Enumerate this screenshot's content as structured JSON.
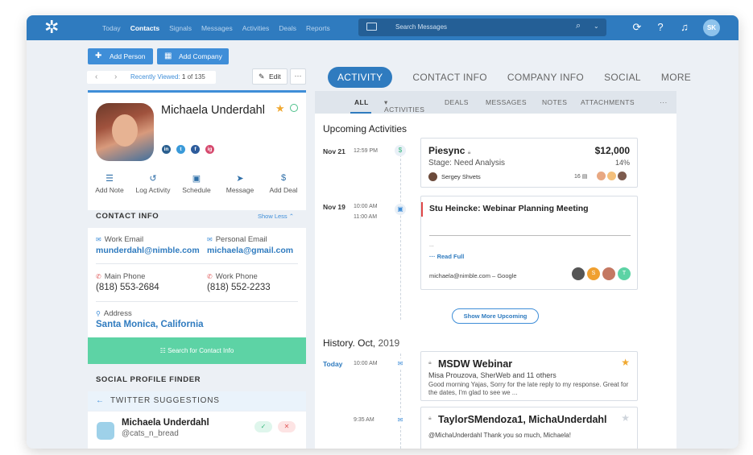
{
  "nav": {
    "items": [
      "Today",
      "Contacts",
      "Signals",
      "Messages",
      "Activities",
      "Deals",
      "Reports"
    ],
    "search_placeholder": "Search Messages",
    "avatar_initials": "SK"
  },
  "toolbar": {
    "add_person": "Add Person",
    "add_company": "Add Company",
    "recently_viewed_label": "Recently Viewed:",
    "recently_viewed_pos": "1",
    "recently_viewed_of": "of",
    "recently_viewed_total": "135",
    "edit": "Edit"
  },
  "profile": {
    "name": "Michaela Underdahl",
    "socials": [
      "in",
      "t",
      "f",
      "ig"
    ],
    "actions": [
      "Add Note",
      "Log Activity",
      "Schedule",
      "Message",
      "Add Deal"
    ]
  },
  "contact_info": {
    "title": "CONTACT INFO",
    "toggle": "Show Less",
    "work_email_label": "Work Email",
    "work_email": "munderdahl@nimble.com",
    "personal_email_label": "Personal Email",
    "personal_email": "michaela@gmail.com",
    "main_phone_label": "Main Phone",
    "main_phone": "(818) 553-2684",
    "work_phone_label": "Work Phone",
    "work_phone": "(818) 552-2233",
    "address_label": "Address",
    "address": "Santa Monica, California",
    "search_button": "Search for Contact Info"
  },
  "social_finder": {
    "title": "SOCIAL PROFILE FINDER",
    "subtitle": "TWITTER SUGGESTIONS",
    "suggestion_name": "Michaela Underdahl",
    "suggestion_handle": "@cats_n_bread"
  },
  "tabs": [
    "ACTIVITY",
    "CONTACT INFO",
    "COMPANY INFO",
    "SOCIAL",
    "MORE"
  ],
  "subtabs": [
    "ALL",
    "ACTIVITIES",
    "DEALS",
    "MESSAGES",
    "NOTES",
    "ATTACHMENTS"
  ],
  "upcoming": {
    "title": "Upcoming Activities",
    "deal": {
      "date": "Nov 21",
      "time": "12:59 PM",
      "name": "Piesync",
      "amount": "$12,000",
      "stage": "Stage: Need Analysis",
      "percent": "14%",
      "owner": "Sergey Shvets",
      "count": "16"
    },
    "meeting": {
      "date": "Nov 19",
      "time_start": "10:00 AM",
      "time_end": "11:00 AM",
      "title": "Stu Heincke: Webinar Planning Meeting",
      "ellipsis": "...",
      "read_full": "Read Full",
      "source": "michaela@nimble.com – Google",
      "attendee_initials": [
        "S",
        "T"
      ]
    },
    "show_more": "Show  More Upcoming"
  },
  "history": {
    "title": "History. Oct,",
    "year": "2019",
    "items": [
      {
        "date": "Today",
        "time": "10:00 AM",
        "title": "MSDW Webinar",
        "subtitle": "Misa Prouzova, SherWeb and 11 others",
        "body": "Good morning Yajas, Sorry for the late reply to my response. Great for the dates, I'm glad to see we ..."
      },
      {
        "time": "9:35 AM",
        "title": "TaylorSMendoza1, MichaUnderdahl",
        "body": "@MichaUnderdahl Thank you so much, Michaela!"
      }
    ]
  },
  "colors": {
    "primary": "#2f7bbf",
    "accent_green": "#5dd3a5",
    "star": "#f0a830"
  }
}
